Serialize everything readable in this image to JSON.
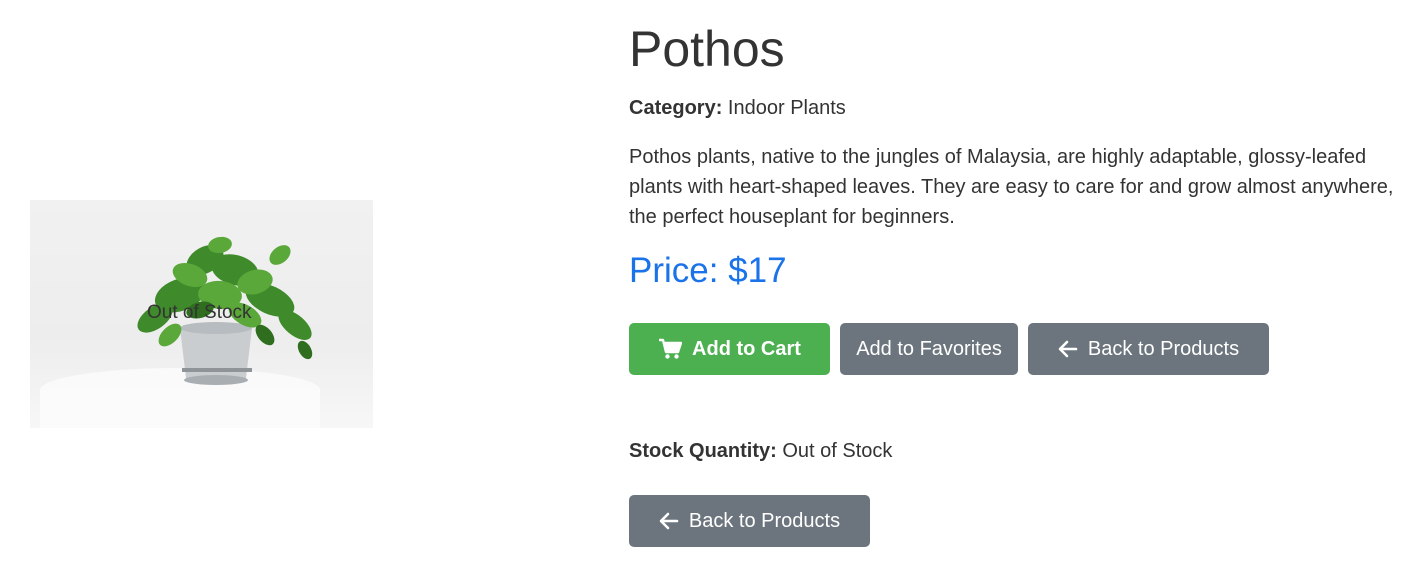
{
  "product": {
    "name": "Pothos",
    "category_label": "Category:",
    "category_value": "Indoor Plants",
    "description": "Pothos plants, native to the jungles of Malaysia, are highly adaptable, glossy-leafed plants with heart-shaped leaves. They are easy to care for and grow almost anywhere, the perfect houseplant for beginners.",
    "price_text": "Price: $17",
    "image_overlay_text": "Out of Stock",
    "stock_label": "Stock Quantity:",
    "stock_value": "Out of Stock"
  },
  "actions": {
    "add_to_cart_label": "Add to Cart",
    "add_to_favorites_label": "Add to Favorites",
    "back_to_products_label": "Back to Products",
    "back_to_products_bottom_label": "Back to Products"
  },
  "icons": {
    "cart": "cart-icon",
    "back": "arrow-left-icon"
  },
  "colors": {
    "price": "#1a73e8",
    "cart_button": "#4caf50",
    "secondary_button": "#6c757d",
    "text": "#333333"
  }
}
